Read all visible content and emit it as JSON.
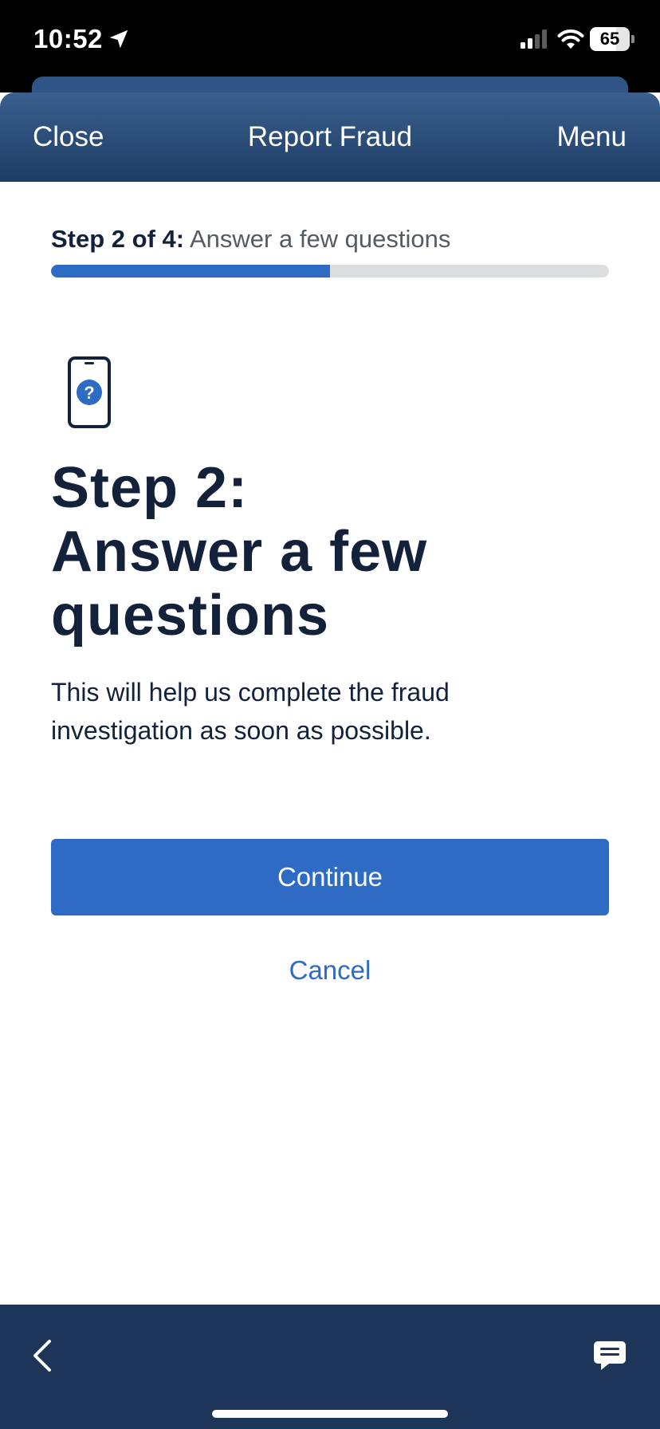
{
  "status_bar": {
    "time": "10:52",
    "battery": "65",
    "battery_level": 0.65
  },
  "header": {
    "close_label": "Close",
    "title": "Report Fraud",
    "menu_label": "Menu"
  },
  "progress": {
    "step_prefix": "Step 2 of 4:",
    "step_text": " Answer a few questions",
    "fraction": 0.5
  },
  "content": {
    "heading_line1": "Step 2:",
    "heading_line2": "Answer a few",
    "heading_line3": "questions",
    "description": "This will help us complete the fraud investigation as soon as possible."
  },
  "actions": {
    "continue_label": "Continue",
    "cancel_label": "Cancel"
  },
  "icons": {
    "location": "location-arrow-icon",
    "signal": "cellular-signal-icon",
    "wifi": "wifi-icon",
    "phone": "phone-question-icon",
    "back": "chevron-left-icon",
    "chat": "chat-bubble-icon"
  },
  "colors": {
    "accent": "#2d6bc4",
    "header": "#2a4b78",
    "navy": "#1c3558",
    "text": "#14213a"
  }
}
